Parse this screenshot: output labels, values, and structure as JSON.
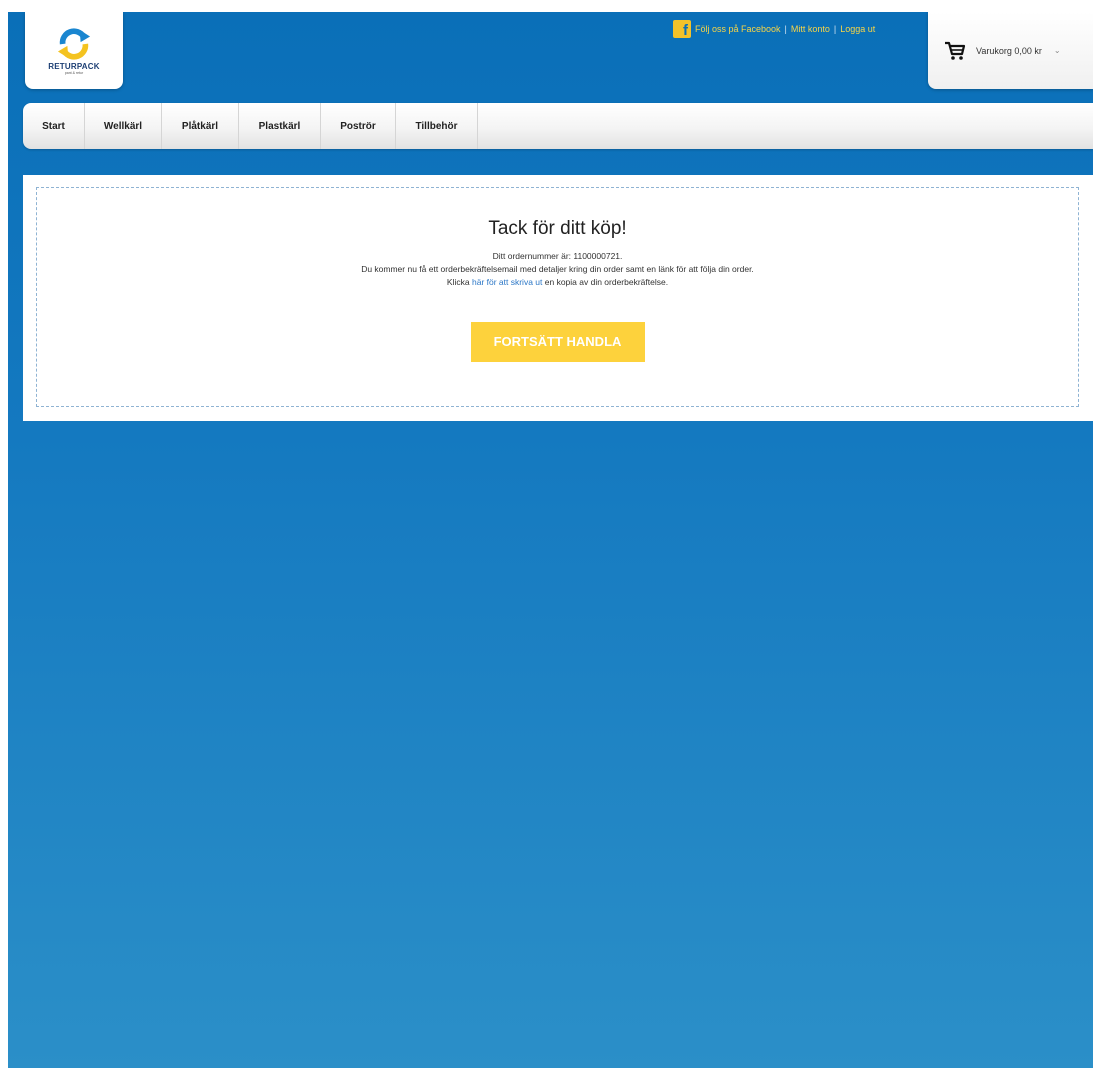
{
  "brand": {
    "name": "RETURPACK",
    "tagline": "pant & retur"
  },
  "toplinks": {
    "facebook": "Följ oss på Facebook",
    "account": "Mitt konto",
    "logout": "Logga ut",
    "separator": "|"
  },
  "cart": {
    "label": "Varukorg 0,00 kr",
    "caret": "⌄"
  },
  "nav": {
    "items": [
      "Start",
      "Wellkärl",
      "Plåtkärl",
      "Plastkärl",
      "Poströr",
      "Tillbehör"
    ]
  },
  "confirmation": {
    "title": "Tack för ditt köp!",
    "order_line": "Ditt ordernummer är: 1100000721.",
    "email_line": "Du kommer nu få ett orderbekräftelsemail med detaljer kring din order samt en länk för att följa din order.",
    "print_prefix": "Klicka",
    "print_link": "här för att skriva ut",
    "print_suffix": "en kopia av din orderbekräftelse.",
    "continue_button": "FORTSÄTT HANDLA"
  },
  "colors": {
    "accent": "#fdd23c",
    "background_top": "#0a6fb8",
    "background_bottom": "#2b8fc8",
    "link": "#2a76c6"
  }
}
